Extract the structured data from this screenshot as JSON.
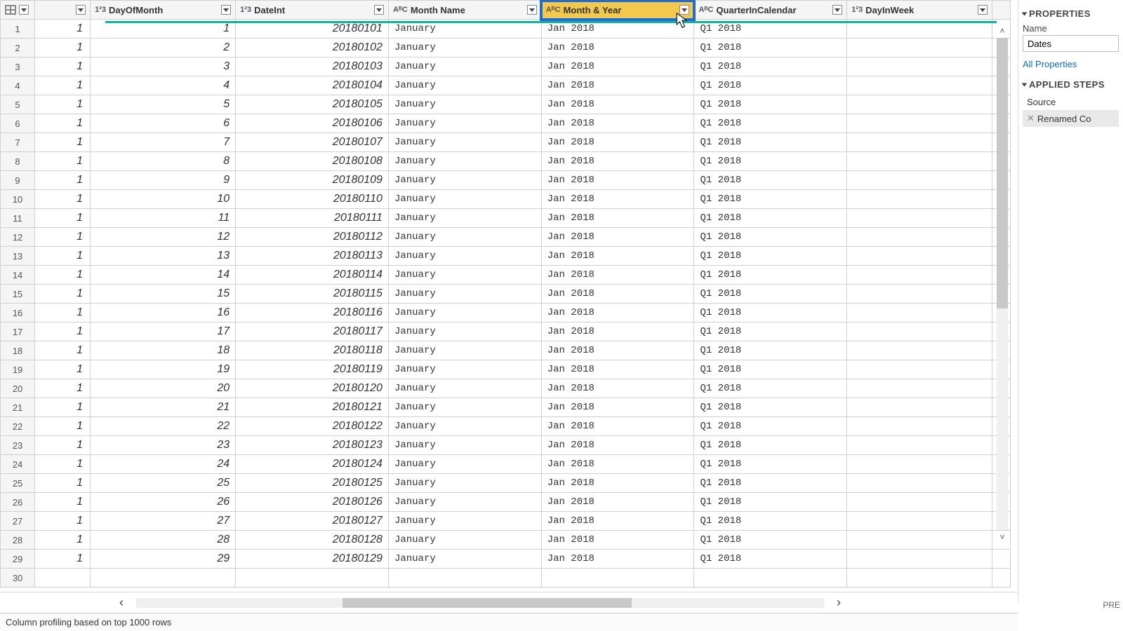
{
  "columns": {
    "dayOfMonth": {
      "label": "DayOfMonth",
      "type": "num"
    },
    "dateInt": {
      "label": "DateInt",
      "type": "num"
    },
    "monthName": {
      "label": "Month Name",
      "type": "txt"
    },
    "monthYear": {
      "label": "Month & Year",
      "type": "txt"
    },
    "quarter": {
      "label": "QuarterInCalendar",
      "type": "txt"
    },
    "dayInWeek": {
      "label": "DayInWeek",
      "type": "num"
    }
  },
  "type_labels": {
    "num": "1²3",
    "txt": "AᴮC"
  },
  "rows": [
    {
      "n": 1,
      "day": 1,
      "di": "20180101",
      "mn": "January",
      "my": "Jan 2018",
      "q": "Q1 2018",
      "dw": ""
    },
    {
      "n": 2,
      "day": 1,
      "di": "20180102",
      "mn": "January",
      "my": "Jan 2018",
      "q": "Q1 2018",
      "dw": ""
    },
    {
      "n": 3,
      "day": 1,
      "di": "20180103",
      "mn": "January",
      "my": "Jan 2018",
      "q": "Q1 2018",
      "dw": ""
    },
    {
      "n": 4,
      "day": 1,
      "di": "20180104",
      "mn": "January",
      "my": "Jan 2018",
      "q": "Q1 2018",
      "dw": ""
    },
    {
      "n": 5,
      "day": 1,
      "di": "20180105",
      "mn": "January",
      "my": "Jan 2018",
      "q": "Q1 2018",
      "dw": ""
    },
    {
      "n": 6,
      "day": 1,
      "di": "20180106",
      "mn": "January",
      "my": "Jan 2018",
      "q": "Q1 2018",
      "dw": ""
    },
    {
      "n": 7,
      "day": 1,
      "di": "20180107",
      "mn": "January",
      "my": "Jan 2018",
      "q": "Q1 2018",
      "dw": ""
    },
    {
      "n": 8,
      "day": 1,
      "di": "20180108",
      "mn": "January",
      "my": "Jan 2018",
      "q": "Q1 2018",
      "dw": ""
    },
    {
      "n": 9,
      "day": 1,
      "di": "20180109",
      "mn": "January",
      "my": "Jan 2018",
      "q": "Q1 2018",
      "dw": ""
    },
    {
      "n": 10,
      "day": 1,
      "di": "20180110",
      "mn": "January",
      "my": "Jan 2018",
      "q": "Q1 2018",
      "dw": ""
    },
    {
      "n": 11,
      "day": 1,
      "di": "20180111",
      "mn": "January",
      "my": "Jan 2018",
      "q": "Q1 2018",
      "dw": ""
    },
    {
      "n": 12,
      "day": 1,
      "di": "20180112",
      "mn": "January",
      "my": "Jan 2018",
      "q": "Q1 2018",
      "dw": ""
    },
    {
      "n": 13,
      "day": 1,
      "di": "20180113",
      "mn": "January",
      "my": "Jan 2018",
      "q": "Q1 2018",
      "dw": ""
    },
    {
      "n": 14,
      "day": 1,
      "di": "20180114",
      "mn": "January",
      "my": "Jan 2018",
      "q": "Q1 2018",
      "dw": ""
    },
    {
      "n": 15,
      "day": 1,
      "di": "20180115",
      "mn": "January",
      "my": "Jan 2018",
      "q": "Q1 2018",
      "dw": ""
    },
    {
      "n": 16,
      "day": 1,
      "di": "20180116",
      "mn": "January",
      "my": "Jan 2018",
      "q": "Q1 2018",
      "dw": ""
    },
    {
      "n": 17,
      "day": 1,
      "di": "20180117",
      "mn": "January",
      "my": "Jan 2018",
      "q": "Q1 2018",
      "dw": ""
    },
    {
      "n": 18,
      "day": 1,
      "di": "20180118",
      "mn": "January",
      "my": "Jan 2018",
      "q": "Q1 2018",
      "dw": ""
    },
    {
      "n": 19,
      "day": 1,
      "di": "20180119",
      "mn": "January",
      "my": "Jan 2018",
      "q": "Q1 2018",
      "dw": ""
    },
    {
      "n": 20,
      "day": 1,
      "di": "20180120",
      "mn": "January",
      "my": "Jan 2018",
      "q": "Q1 2018",
      "dw": ""
    },
    {
      "n": 21,
      "day": 1,
      "di": "20180121",
      "mn": "January",
      "my": "Jan 2018",
      "q": "Q1 2018",
      "dw": ""
    },
    {
      "n": 22,
      "day": 1,
      "di": "20180122",
      "mn": "January",
      "my": "Jan 2018",
      "q": "Q1 2018",
      "dw": ""
    },
    {
      "n": 23,
      "day": 1,
      "di": "20180123",
      "mn": "January",
      "my": "Jan 2018",
      "q": "Q1 2018",
      "dw": ""
    },
    {
      "n": 24,
      "day": 1,
      "di": "20180124",
      "mn": "January",
      "my": "Jan 2018",
      "q": "Q1 2018",
      "dw": ""
    },
    {
      "n": 25,
      "day": 1,
      "di": "20180125",
      "mn": "January",
      "my": "Jan 2018",
      "q": "Q1 2018",
      "dw": ""
    },
    {
      "n": 26,
      "day": 1,
      "di": "20180126",
      "mn": "January",
      "my": "Jan 2018",
      "q": "Q1 2018",
      "dw": ""
    },
    {
      "n": 27,
      "day": 1,
      "di": "20180127",
      "mn": "January",
      "my": "Jan 2018",
      "q": "Q1 2018",
      "dw": ""
    },
    {
      "n": 28,
      "day": 1,
      "di": "20180128",
      "mn": "January",
      "my": "Jan 2018",
      "q": "Q1 2018",
      "dw": ""
    },
    {
      "n": 29,
      "day": 1,
      "di": "20180129",
      "mn": "January",
      "my": "Jan 2018",
      "q": "Q1 2018",
      "dw": ""
    },
    {
      "n": 30,
      "day": "",
      "di": "",
      "mn": "",
      "my": "",
      "q": "",
      "dw": ""
    }
  ],
  "dateint_values": [
    1,
    2,
    3,
    4,
    5,
    6,
    7,
    8,
    9,
    10,
    11,
    12,
    13,
    14,
    15,
    16,
    17,
    18,
    19,
    20,
    21,
    22,
    23,
    24,
    25,
    26,
    27,
    28,
    29,
    ""
  ],
  "panel": {
    "props_title": "PROPERTIES",
    "name_label": "Name",
    "name_value": "Dates",
    "all_props": "All Properties",
    "steps_title": "APPLIED STEPS",
    "steps": [
      "Source",
      "Renamed Co"
    ],
    "selected_step_index": 1
  },
  "status": {
    "text": "Column profiling based on top 1000 rows",
    "right": "PRE"
  }
}
